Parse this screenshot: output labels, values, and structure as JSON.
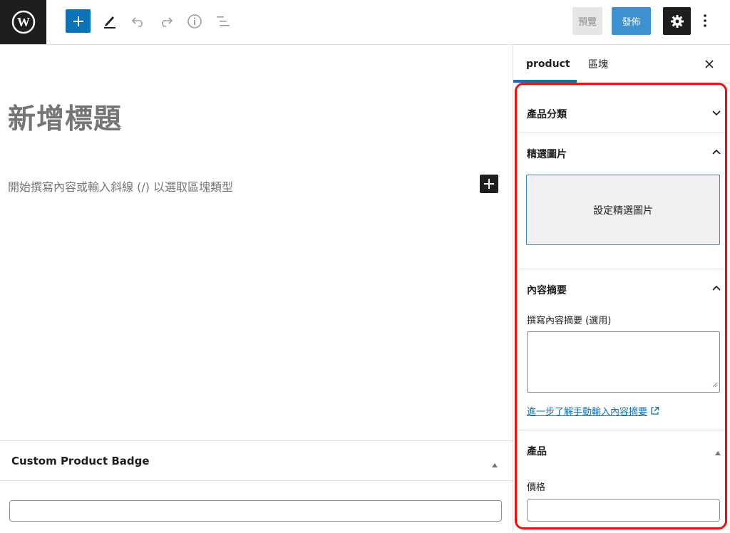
{
  "toolbar": {
    "preview_label": "預覽",
    "publish_label": "發佈",
    "accent_color": "#0a73b7",
    "icons": [
      "wordpress-logo-icon",
      "plus-icon",
      "pencil-icon",
      "undo-icon",
      "redo-icon",
      "info-icon",
      "list-view-icon",
      "gear-icon",
      "more-vertical-icon"
    ]
  },
  "editor": {
    "title_placeholder": "新增標題",
    "content_placeholder": "開始撰寫內容或輸入斜線 (/) 以選取區塊類型"
  },
  "metabox": {
    "title": "Custom Product Badge",
    "input_value": ""
  },
  "sidebar": {
    "tabs": [
      {
        "label": "product",
        "active": true
      },
      {
        "label": "區塊",
        "active": false
      }
    ],
    "panels": {
      "category": {
        "title": "產品分類",
        "expanded": false
      },
      "featured_image": {
        "title": "精選圖片",
        "expanded": true,
        "button_label": "設定精選圖片"
      },
      "excerpt": {
        "title": "內容摘要",
        "expanded": true,
        "field_label": "撰寫內容摘要 (選用)",
        "field_value": "",
        "link_text": "進一步了解手動輸入內容摘要"
      },
      "product": {
        "title": "產品",
        "expanded": true,
        "price_label": "價格",
        "price_value": ""
      }
    }
  },
  "highlight_color": "#e8140c"
}
